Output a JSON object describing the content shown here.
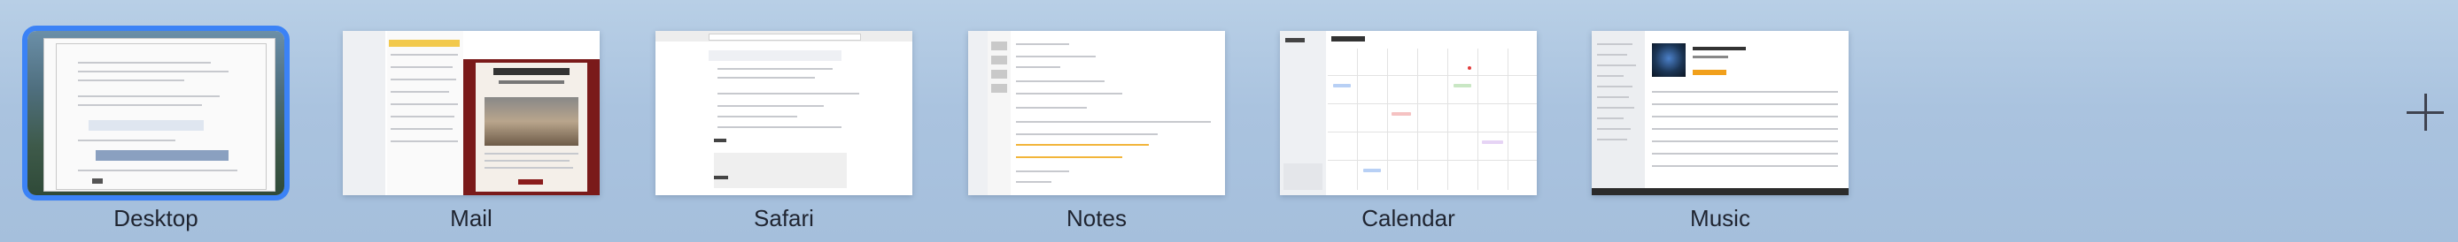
{
  "spaces": [
    {
      "id": "desktop",
      "label": "Desktop",
      "selected": true
    },
    {
      "id": "mail",
      "label": "Mail",
      "selected": false
    },
    {
      "id": "safari",
      "label": "Safari",
      "selected": false
    },
    {
      "id": "notes",
      "label": "Notes",
      "selected": false
    },
    {
      "id": "calendar",
      "label": "Calendar",
      "selected": false
    },
    {
      "id": "music",
      "label": "Music",
      "selected": false
    }
  ],
  "add_space": {
    "icon": "plus-icon"
  },
  "colors": {
    "selection_outline": "#3b82f6",
    "label_text": "#1f2430",
    "background_top": "#b8cfe6",
    "background_bottom": "#a5bfdc"
  }
}
